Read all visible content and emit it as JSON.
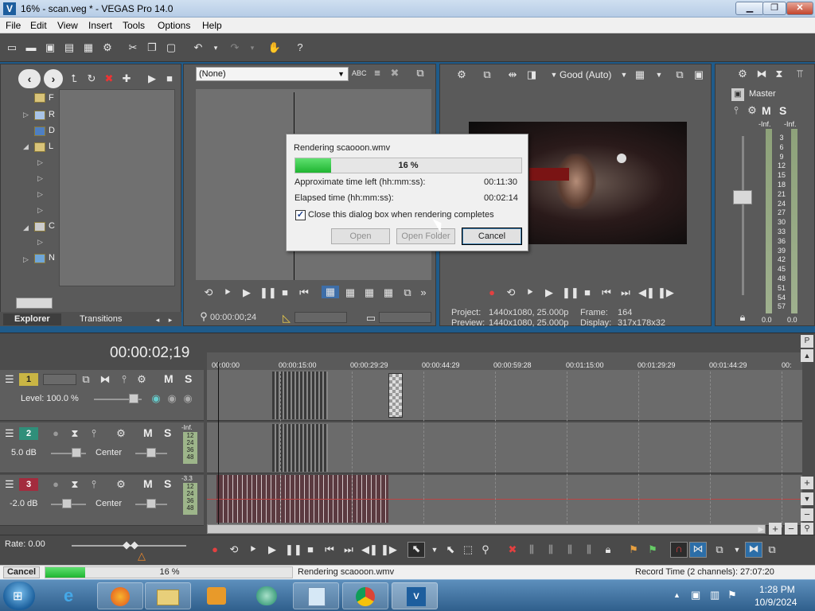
{
  "window": {
    "title": "16% - scan.veg * - VEGAS Pro 14.0",
    "minimize": "▁",
    "maximize": "❐",
    "close": "✕"
  },
  "menu": [
    "File",
    "Edit",
    "View",
    "Insert",
    "Tools",
    "Options",
    "Help"
  ],
  "explorer": {
    "tabs": [
      "Explorer",
      "Transitions"
    ],
    "tree_letters": [
      "F",
      "R",
      "D",
      "L",
      "C",
      "N"
    ]
  },
  "trimmer": {
    "select_value": "(None)",
    "timecode": "00:00:00;24"
  },
  "preview": {
    "quality": "Good (Auto)",
    "project_label": "Project:",
    "project_value": "1440x1080, 25.000p",
    "preview_label": "Preview:",
    "preview_value": "1440x1080, 25.000p",
    "frame_label": "Frame:",
    "frame_value": "164",
    "display_label": "Display:",
    "display_value": "317x178x32"
  },
  "master": {
    "title": "Master",
    "db_left": "-Inf.",
    "db_right": "-Inf.",
    "scale": [
      "3",
      "6",
      "9",
      "12",
      "15",
      "18",
      "21",
      "24",
      "27",
      "30",
      "33",
      "36",
      "39",
      "42",
      "45",
      "48",
      "51",
      "54",
      "57"
    ],
    "bottom_left": "0.0",
    "bottom_right": "0.0"
  },
  "timeline": {
    "timecode": "00:00:02;19",
    "ruler": [
      "00:00:00",
      "00:00:15:00",
      "00:00:29:29",
      "00:00:44:29",
      "00:00:59:28",
      "00:01:15:00",
      "00:01:29:29",
      "00:01:44:29",
      "00:"
    ],
    "tracks": [
      {
        "num": "1",
        "level": "Level: 100.0 %",
        "m": "M",
        "s": "S"
      },
      {
        "num": "2",
        "level": "5.0 dB",
        "pan": "Center",
        "m": "M",
        "s": "S",
        "peak": "-Inf.",
        "meter": [
          "12",
          "24",
          "36",
          "48"
        ]
      },
      {
        "num": "3",
        "level": "-2.0 dB",
        "pan": "Center",
        "m": "M",
        "s": "S",
        "peak": "-3.3",
        "meter": [
          "12",
          "24",
          "36",
          "48"
        ]
      }
    ],
    "rate": "Rate: 0.00"
  },
  "render_dialog": {
    "title": "Rendering scaooon.wmv",
    "progress_text": "16 %",
    "progress": 0.16,
    "time_left_label": "Approximate time left (hh:mm:ss):",
    "time_left_value": "00:11:30",
    "elapsed_label": "Elapsed time (hh:mm:ss):",
    "elapsed_value": "00:02:14",
    "checkbox_label": "Close this dialog box when rendering completes",
    "checked": true,
    "buttons": {
      "open": "Open",
      "open_folder": "Open Folder",
      "cancel": "Cancel"
    }
  },
  "status": {
    "cancel": "Cancel",
    "progress_text": "16 %",
    "progress": 0.16,
    "message": "Rendering scaooon.wmv",
    "record_time": "Record Time (2 channels): 27:07:20"
  },
  "taskbar": {
    "time": "1:28 PM",
    "date": "10/9/2024"
  },
  "colors": {
    "progress_green": "#22c83a",
    "toolbar_dark": "#4e4e4e",
    "taskbar_blue": "#2f5f8c"
  }
}
